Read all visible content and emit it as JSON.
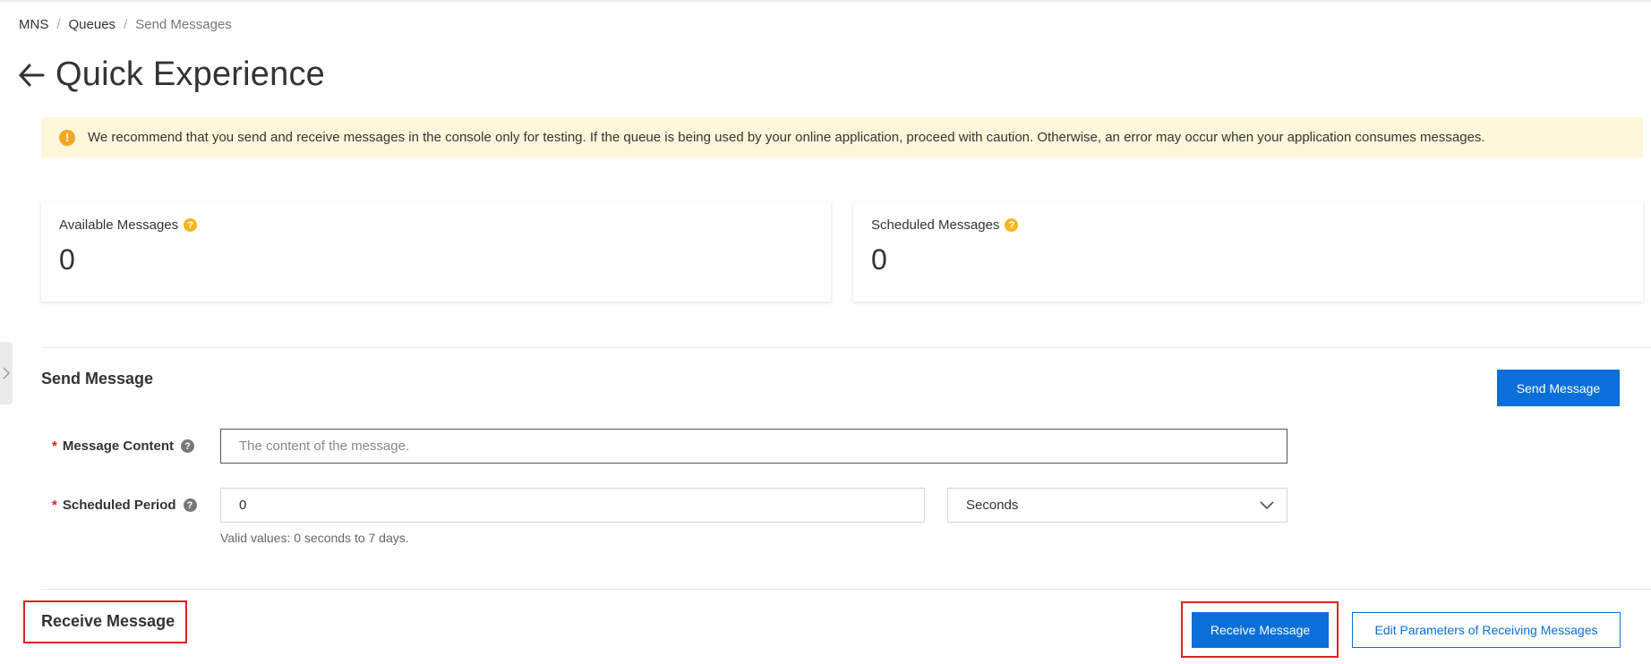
{
  "breadcrumb": {
    "items": [
      "MNS",
      "Queues",
      "Send Messages"
    ],
    "separator": "/"
  },
  "header": {
    "title": "Quick Experience",
    "back_icon": "arrow-left-icon"
  },
  "alert": {
    "icon": "warning-icon",
    "icon_glyph": "!",
    "text": "We recommend that you send and receive messages in the console only for testing. If the queue is being used by your online application, proceed with caution. Otherwise, an error may occur when your application consumes messages."
  },
  "stats": {
    "available": {
      "label": "Available Messages",
      "value": "0"
    },
    "scheduled": {
      "label": "Scheduled Messages",
      "value": "0"
    },
    "help_glyph": "?"
  },
  "send_section": {
    "title": "Send Message",
    "button_label": "Send Message",
    "message_content": {
      "label": "Message Content",
      "required_mark": "*",
      "placeholder": "The content of the message.",
      "value": ""
    },
    "scheduled_period": {
      "label": "Scheduled Period",
      "required_mark": "*",
      "value": "0",
      "unit_selected": "Seconds",
      "hint": "Valid values: 0 seconds to 7 days."
    },
    "help_glyph": "?"
  },
  "receive_section": {
    "title": "Receive Message",
    "receive_button_label": "Receive Message",
    "edit_button_label": "Edit Parameters of Receiving Messages"
  },
  "colors": {
    "primary": "#0a6fd8",
    "alert_bg": "#fff7db",
    "warning": "#f5a623",
    "highlight_box": "#e02020"
  }
}
